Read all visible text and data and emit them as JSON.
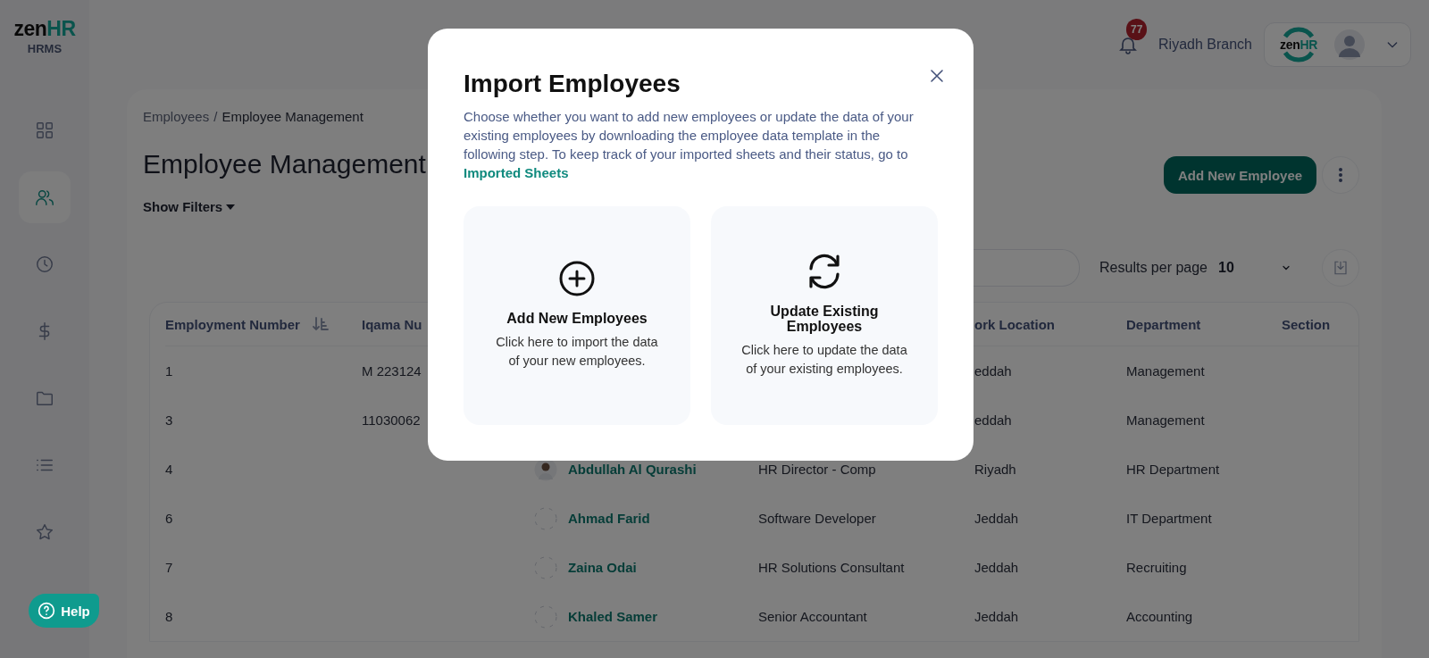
{
  "sidebar": {
    "logo": {
      "name": "zen",
      "accent": "HR",
      "product": "HRMS"
    },
    "items": [
      {
        "selected": false
      },
      {
        "selected": true
      },
      {
        "selected": false
      },
      {
        "selected": false
      },
      {
        "selected": false
      },
      {
        "selected": false
      },
      {
        "selected": false
      }
    ],
    "help_button": "Help"
  },
  "header": {
    "notification_count": "77",
    "branch": "Riyadh Branch",
    "company_logo": {
      "name": "zen",
      "accent": "HR"
    }
  },
  "page": {
    "breadcrumb": [
      {
        "label": "Employees",
        "current": false
      },
      {
        "label": "Employee Management",
        "current": true
      }
    ],
    "breadcrumb_separator": "/",
    "title": "Employee Management",
    "filters_toggle": "Show Filters",
    "add_button": "Add New Employee",
    "results_per_page": {
      "label": "Results per page",
      "value": "10"
    }
  },
  "table": {
    "columns": {
      "employment_number": {
        "label": "Employment Number",
        "sorted": true
      },
      "iqama_number": {
        "label": "Iqama Nu",
        "sorted": false
      },
      "work_location": {
        "label": "ork Location",
        "sorted": false
      },
      "department": {
        "label": "Department",
        "sorted": false
      },
      "section": {
        "label": "Section",
        "sorted": false
      }
    },
    "rows": [
      {
        "employment_number": "1",
        "iqama_number": "M 223124",
        "work_location": "eddah",
        "department": "Management"
      },
      {
        "employment_number": "3",
        "iqama_number": "11030062",
        "work_location": "eddah",
        "department": "Management"
      },
      {
        "employment_number": "4",
        "employee": {
          "name": "Abdullah Al Qurashi",
          "has_photo": true
        },
        "job_title": "HR Director - Comp",
        "work_location": "Riyadh",
        "department": "HR Department"
      },
      {
        "employment_number": "6",
        "employee": {
          "name": "Ahmad Farid",
          "has_photo": false
        },
        "job_title": "Software Developer",
        "work_location": "Jeddah",
        "department": "IT Department"
      },
      {
        "employment_number": "7",
        "employee": {
          "name": "Zaina Odai",
          "has_photo": false
        },
        "job_title": "HR Solutions Consultant",
        "work_location": "Jeddah",
        "department": "Recruiting"
      },
      {
        "employment_number": "8",
        "employee": {
          "name": "Khaled Samer",
          "has_photo": false
        },
        "job_title": "Senior Accountant",
        "work_location": "Jeddah",
        "department": "Accounting"
      }
    ]
  },
  "modal": {
    "title": "Import Employees",
    "description": "Choose whether you want to add new employees or update the data of your existing employees by downloading the employee data template in the following step. To keep track of your imported sheets and their status, go to",
    "link": "Imported Sheets",
    "options": [
      {
        "kind": "add",
        "title": "Add New Employees",
        "description": "Click here to import the data of your new employees."
      },
      {
        "kind": "update",
        "title": "Update Existing Employees",
        "description": "Click here to update the data of your existing employees."
      }
    ]
  }
}
